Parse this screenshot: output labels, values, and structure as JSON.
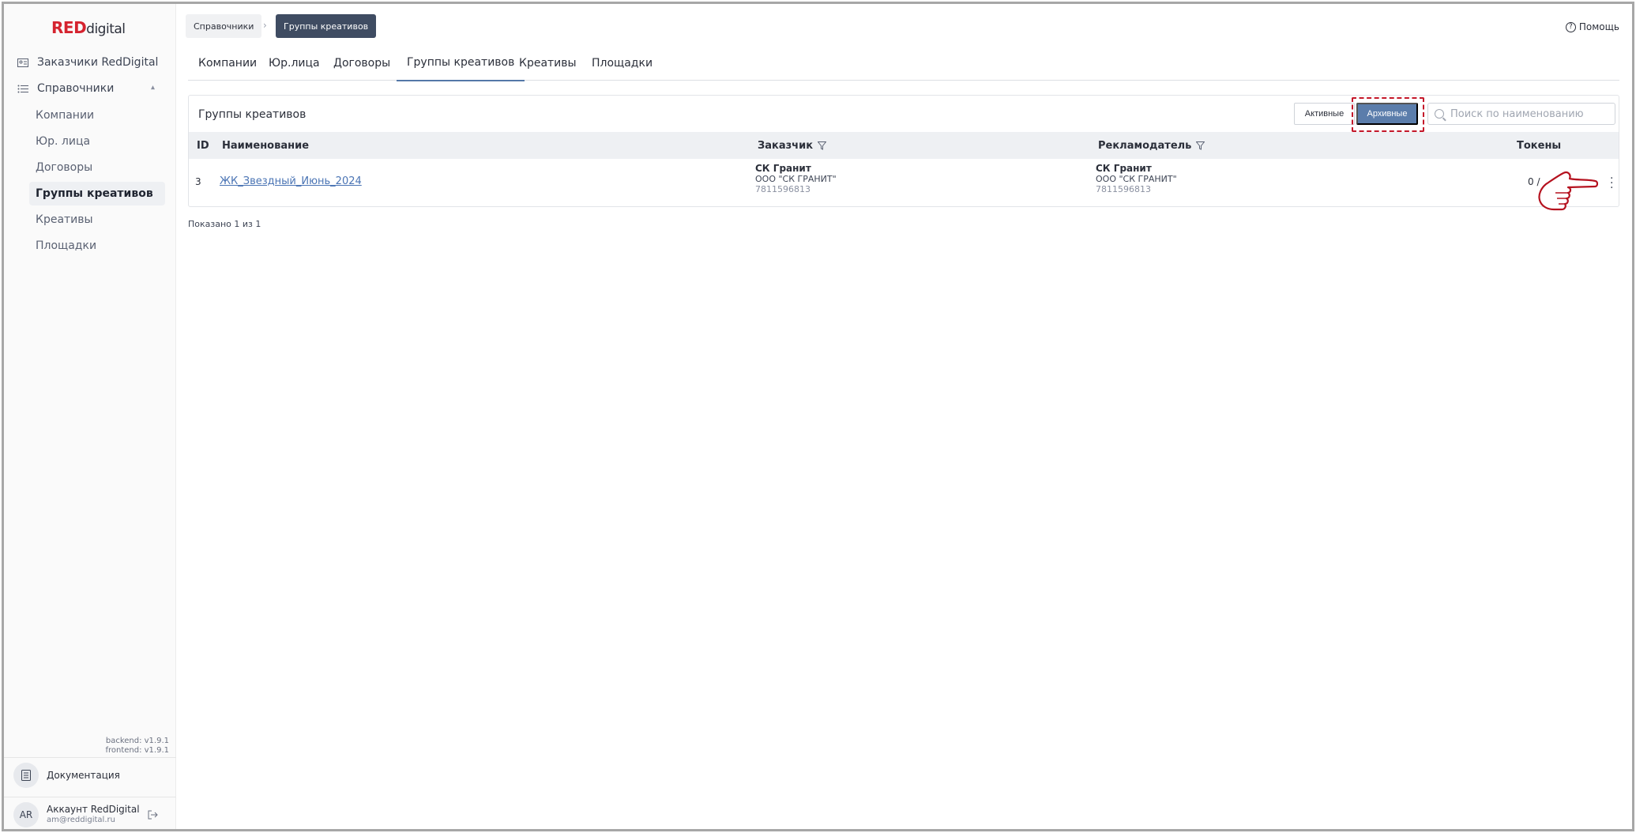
{
  "sidebar": {
    "logo_red": "RED",
    "logo_rest": "digital",
    "top_item": "Заказчики RedDigital",
    "section": "Справочники",
    "items": [
      {
        "label": "Компании"
      },
      {
        "label": "Юр. лица"
      },
      {
        "label": "Договоры"
      },
      {
        "label": "Группы креативов",
        "active": true
      },
      {
        "label": "Креативы"
      },
      {
        "label": "Площадки"
      }
    ],
    "backend_version": "backend: v1.9.1",
    "frontend_version": "frontend: v1.9.1",
    "docs_label": "Документация",
    "account_initials": "AR",
    "account_name": "Аккаунт RedDigital",
    "account_email": "am@reddigital.ru"
  },
  "breadcrumb": {
    "parent": "Справочники",
    "current": "Группы креативов"
  },
  "help_label": "Помощь",
  "tabs": [
    {
      "label": "Компании"
    },
    {
      "label": "Юр.лица"
    },
    {
      "label": "Договоры"
    },
    {
      "label": "Группы креативов",
      "active": true
    },
    {
      "label": "Креативы"
    },
    {
      "label": "Площадки"
    }
  ],
  "card": {
    "title": "Группы креативов",
    "btn_active": "Активные",
    "btn_archived": "Архивные",
    "search_placeholder": "Поиск по наименованию",
    "columns": {
      "id": "ID",
      "name": "Наименование",
      "customer": "Заказчик",
      "advertiser": "Рекламодатель",
      "tokens": "Токены"
    },
    "rows": [
      {
        "id": "3",
        "name": "ЖК_Звездный_Июнь_2024",
        "customer_name": "СК Гранит",
        "customer_org": "ООО \"СК ГРАНИТ\"",
        "customer_inn": "7811596813",
        "advertiser_name": "СК Гранит",
        "advertiser_org": "ООО \"СК ГРАНИТ\"",
        "advertiser_inn": "7811596813",
        "tokens": "0 /"
      }
    ]
  },
  "shown_text": "Показано 1 из 1",
  "colors": {
    "brand_red": "#d5232f",
    "accent_blue": "#5b7dab",
    "highlight": "#c4182a"
  }
}
